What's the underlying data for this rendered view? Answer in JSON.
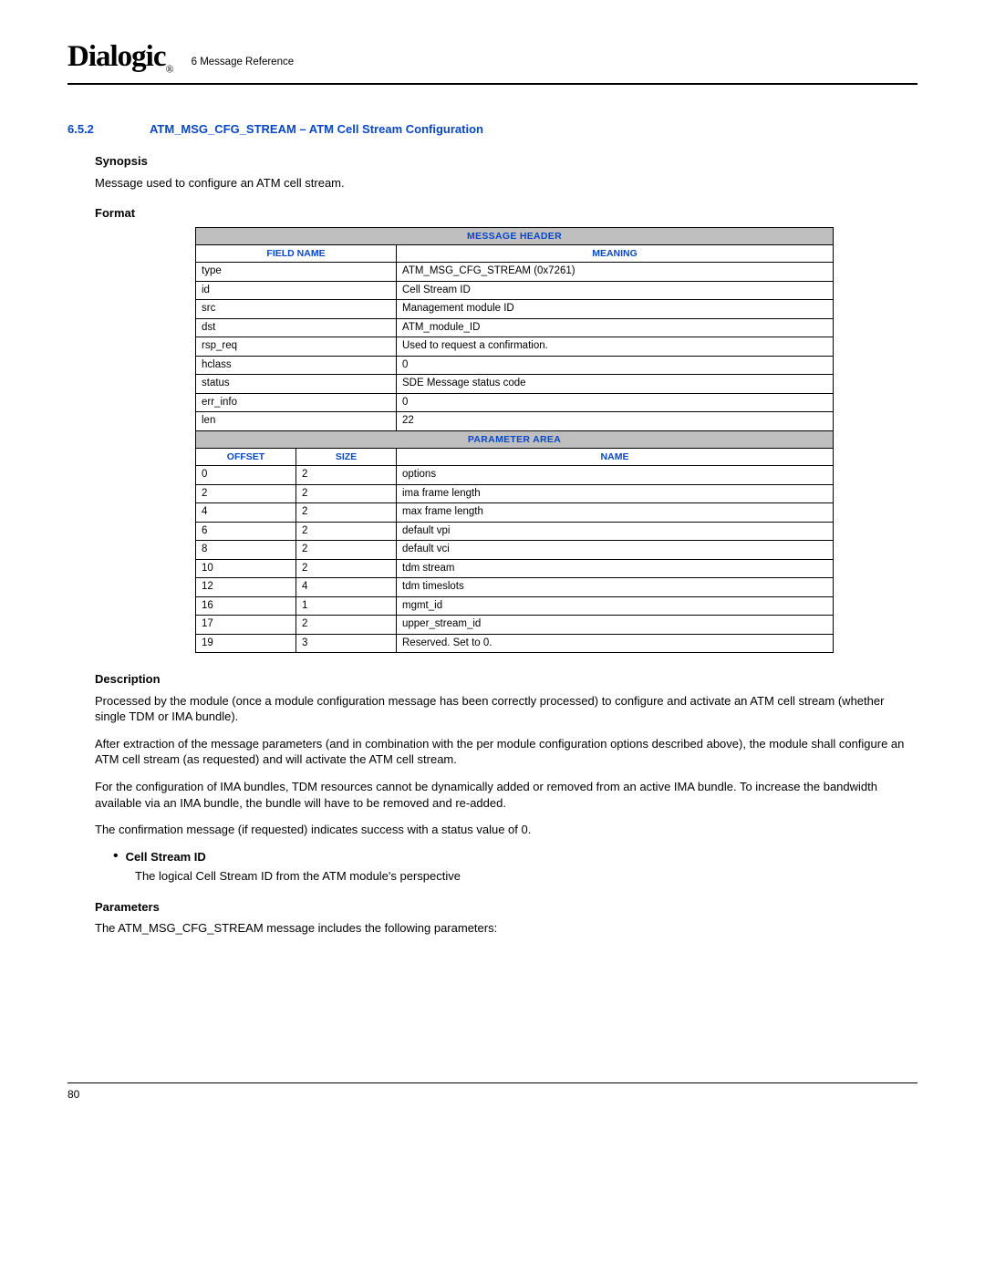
{
  "header": {
    "logo_text": "Dialogic",
    "logo_reg": "®",
    "breadcrumb": "6 Message Reference"
  },
  "section": {
    "number": "6.5.2",
    "title": "ATM_MSG_CFG_STREAM – ATM Cell Stream Configuration"
  },
  "synopsis": {
    "heading": "Synopsis",
    "text": "Message used to configure an ATM cell stream."
  },
  "format": {
    "heading": "Format",
    "message_header_label": "MESSAGE HEADER",
    "field_name_label": "FIELD NAME",
    "meaning_label": "MEANING",
    "header_rows": [
      {
        "field": "type",
        "meaning": "ATM_MSG_CFG_STREAM (0x7261)"
      },
      {
        "field": "id",
        "meaning": "Cell Stream ID"
      },
      {
        "field": "src",
        "meaning": "Management module ID"
      },
      {
        "field": "dst",
        "meaning": "ATM_module_ID"
      },
      {
        "field": "rsp_req",
        "meaning": "Used to request a confirmation."
      },
      {
        "field": "hclass",
        "meaning": "0"
      },
      {
        "field": "status",
        "meaning": "SDE Message status code"
      },
      {
        "field": "err_info",
        "meaning": "0"
      },
      {
        "field": "len",
        "meaning": "22"
      }
    ],
    "parameter_area_label": "PARAMETER AREA",
    "offset_label": "OFFSET",
    "size_label": "SIZE",
    "name_label": "NAME",
    "param_rows": [
      {
        "offset": "0",
        "size": "2",
        "name": "options"
      },
      {
        "offset": "2",
        "size": "2",
        "name": "ima frame length"
      },
      {
        "offset": "4",
        "size": "2",
        "name": "max frame length"
      },
      {
        "offset": "6",
        "size": "2",
        "name": "default vpi"
      },
      {
        "offset": "8",
        "size": "2",
        "name": "default vci"
      },
      {
        "offset": "10",
        "size": "2",
        "name": "tdm stream"
      },
      {
        "offset": "12",
        "size": "4",
        "name": "tdm timeslots"
      },
      {
        "offset": "16",
        "size": "1",
        "name": "mgmt_id"
      },
      {
        "offset": "17",
        "size": "2",
        "name": "upper_stream_id"
      },
      {
        "offset": "19",
        "size": "3",
        "name": "Reserved. Set to 0."
      }
    ]
  },
  "description": {
    "heading": "Description",
    "p1": "Processed by the module (once a module configuration message has been correctly processed) to configure and activate an ATM cell stream (whether single TDM or IMA bundle).",
    "p2": "After extraction of the message parameters (and in combination with the per module configuration options described above), the module shall configure an ATM cell stream (as requested) and will activate the ATM cell stream.",
    "p3": "For the configuration of IMA bundles, TDM resources cannot be dynamically added or removed from an active IMA bundle. To increase the bandwidth available via an IMA bundle, the bundle will have to be removed and re-added.",
    "p4": "The confirmation message (if requested) indicates success with a status value of 0.",
    "bullet_label": "Cell Stream ID",
    "bullet_text": "The logical Cell Stream ID from the ATM module's perspective"
  },
  "parameters": {
    "heading": "Parameters",
    "text": "The ATM_MSG_CFG_STREAM message includes the following parameters:"
  },
  "footer": {
    "page": "80"
  }
}
